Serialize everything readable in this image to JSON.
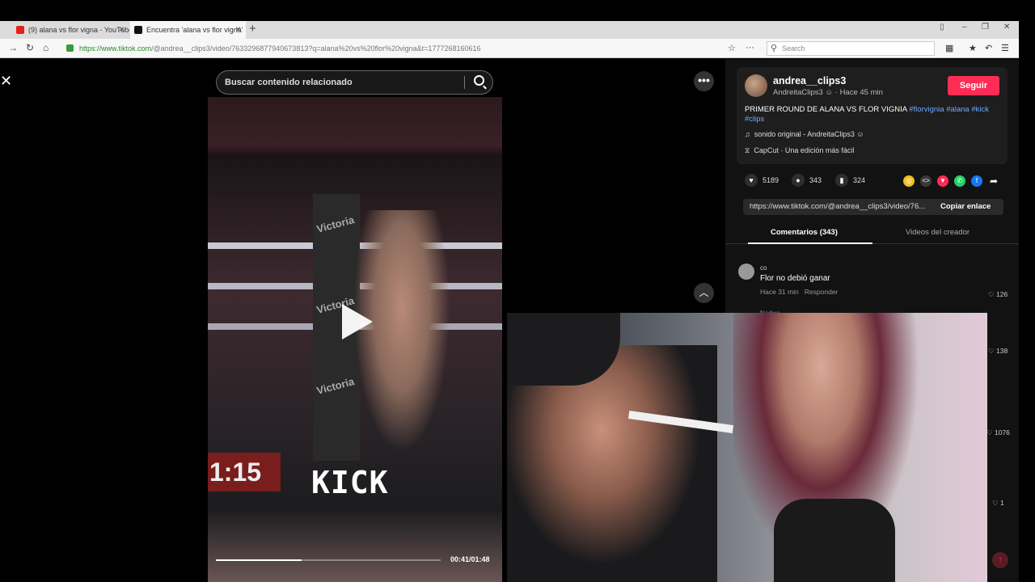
{
  "browser": {
    "tabs": [
      {
        "label": "(9) alana vs flor vigna - YouTube",
        "favicon_color": "#e62117"
      },
      {
        "label": "Encuentra 'alana vs flor vigna'",
        "favicon_color": "#111111"
      }
    ],
    "url_prefix": "https://www.tiktok.com",
    "url_rest": "/@andrea__clips3/video/7633296877940673813?q=alana%20vs%20flor%20vigna&t=1777268160616",
    "search_placeholder": "Search"
  },
  "search_related": {
    "placeholder": "Buscar contenido relacionado"
  },
  "video": {
    "overlay_timer": "1:15",
    "overlay_brand": "KICK",
    "pillar_text": [
      "Victoria",
      "Victoria",
      "Victoria"
    ],
    "current_time": "00:41",
    "duration": "01:48",
    "time_display": "00:41/01:48",
    "progress_fraction": 0.38
  },
  "author": {
    "username": "andrea__clips3",
    "display_line": "AndreitaClips3 ☺ · Hace 45 min",
    "follow_label": "Seguir"
  },
  "description": {
    "text": "PRIMER ROUND DE ALANA VS FLOR VIGNIA ",
    "hashtags": "#florvignia #alana #kick #clips",
    "sound": "sonido original - AndreitaClips3 ☺",
    "capcut": "CapCut · Una edición más fácil"
  },
  "actions": {
    "likes": "5189",
    "comments": "343",
    "saves": "324"
  },
  "share_colors": [
    "#f0c020",
    "#3a3a3a",
    "#fe2c55",
    "#25d366",
    "#1877f2"
  ],
  "link": {
    "text": "https://www.tiktok.com/@andrea__clips3/video/76...",
    "copy_label": "Copiar enlace"
  },
  "panel_tabs": {
    "comments": "Comentarios (343)",
    "creator_videos": "Videos del creador"
  },
  "comments": [
    {
      "user": "co",
      "text": "Flor no debió ganar",
      "time": "Hace 31 min",
      "reply": "Responder",
      "likes": "126"
    }
  ],
  "like_counts": [
    "138",
    "1076",
    "1"
  ],
  "partial_user": "Nadwa"
}
